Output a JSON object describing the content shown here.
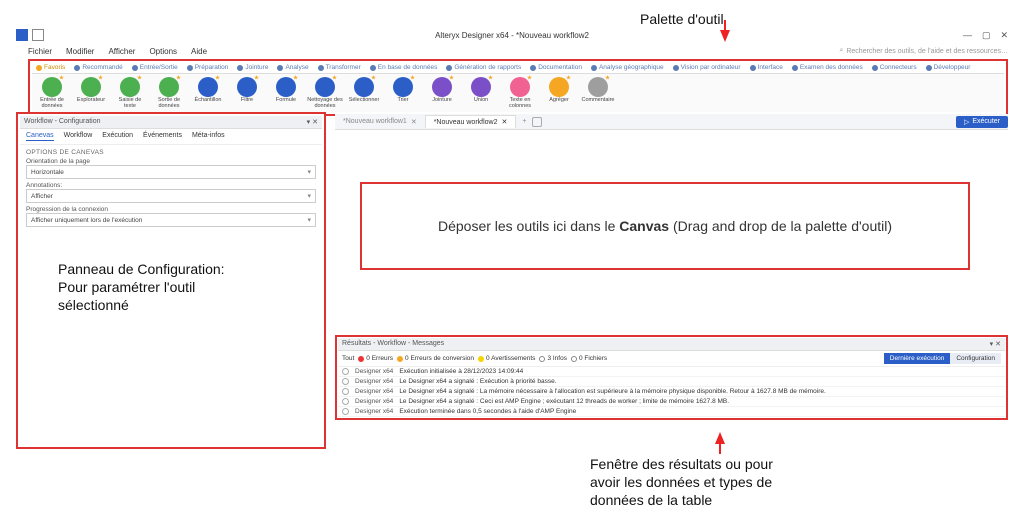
{
  "annotations": {
    "palette": "Palette d'outil",
    "config_line1": "Panneau de Configuration:",
    "config_line2": "Pour paramétrer l'outil",
    "config_line3": "sélectionné",
    "canvas_prefix": "Déposer les outils ici dans le ",
    "canvas_bold": "Canvas",
    "canvas_suffix": " (Drag and drop de la palette d'outil)",
    "results_line1": "Fenêtre des résultats ou pour",
    "results_line2": "avoir les données et types de",
    "results_line3": "données de la table"
  },
  "titlebar": {
    "app_title": "Alteryx Designer x64 - *Nouveau workflow2",
    "min": "—",
    "max": "▢",
    "close": "✕"
  },
  "menubar": {
    "items": [
      "Fichier",
      "Modifier",
      "Afficher",
      "Options",
      "Aide"
    ],
    "search_placeholder": "Rechercher des outils, de l'aide et des ressources…",
    "search_icon": "⌕"
  },
  "palette": {
    "tabs": [
      "Favoris",
      "Recommandé",
      "Entrée/Sortie",
      "Préparation",
      "Jointure",
      "Analyse",
      "Transformer",
      "En base de données",
      "Génération de rapports",
      "Documentation",
      "Analyse géographique",
      "Vision par ordinateur",
      "Interface",
      "Examen des données",
      "Connecteurs",
      "Développeur"
    ],
    "tools": [
      {
        "label": "Entrée de données",
        "color": "#4caf50"
      },
      {
        "label": "Explorateur",
        "color": "#4caf50"
      },
      {
        "label": "Saisie de texte",
        "color": "#4caf50"
      },
      {
        "label": "Sortie de données",
        "color": "#4caf50"
      },
      {
        "label": "Échantillon",
        "color": "#2b5fc7"
      },
      {
        "label": "Filtre",
        "color": "#2b5fc7"
      },
      {
        "label": "Formule",
        "color": "#2b5fc7"
      },
      {
        "label": "Nettoyage des données",
        "color": "#2b5fc7"
      },
      {
        "label": "Sélectionner",
        "color": "#2b5fc7"
      },
      {
        "label": "Trier",
        "color": "#2b5fc7"
      },
      {
        "label": "Jointure",
        "color": "#7b4fc7"
      },
      {
        "label": "Union",
        "color": "#7b4fc7"
      },
      {
        "label": "Texte en colonnes",
        "color": "#f06292"
      },
      {
        "label": "Agréger",
        "color": "#f5a623"
      },
      {
        "label": "Commentaire",
        "color": "#9e9e9e"
      }
    ]
  },
  "config_panel": {
    "title": "Workflow - Configuration",
    "tabs": [
      "Canevas",
      "Workflow",
      "Exécution",
      "Événements",
      "Méta-infos"
    ],
    "section": "OPTIONS DE CANEVAS",
    "orientation_label": "Orientation de la page",
    "orientation_value": "Horizontale",
    "annotations_label": "Annotations:",
    "annotations_value": "Afficher",
    "progress_label": "Progression de la connexion",
    "progress_value": "Afficher uniquement lors de l'exécution"
  },
  "canvas_tabs": {
    "tab1": "*Nouveau workflow1",
    "tab2": "*Nouveau workflow2",
    "run": "Exécuter",
    "play": "▷"
  },
  "results": {
    "title": "Résultats - Workflow - Messages",
    "filters": {
      "all": "Tout",
      "errors": "0 Erreurs",
      "conv": "0 Erreurs de conversion",
      "warn": "0 Avertissements",
      "msgs": "3 Infos",
      "files": "0 Fichiers"
    },
    "right_buttons": {
      "last": "Dernière exécution",
      "config": "Configuration"
    },
    "rows": [
      {
        "src": "Designer x64",
        "txt": "Exécution initialisée à 28/12/2023 14:09:44"
      },
      {
        "src": "Designer x64",
        "txt": "Le Designer x64 a signalé : Exécution à priorité basse."
      },
      {
        "src": "Designer x64",
        "txt": "Le Designer x64 a signalé : La mémoire nécessaire à l'allocation est supérieure à la mémoire physique disponible.  Retour à 1627.8 MB de mémoire."
      },
      {
        "src": "Designer x64",
        "txt": "Le Designer x64 a signalé : Ceci est AMP Engine ; exécutant 12 threads de worker ; limite de mémoire 1627.8 MB."
      },
      {
        "src": "Designer x64",
        "txt": "Exécution terminée dans 0,5 secondes à l'aide d'AMP Engine"
      }
    ]
  }
}
